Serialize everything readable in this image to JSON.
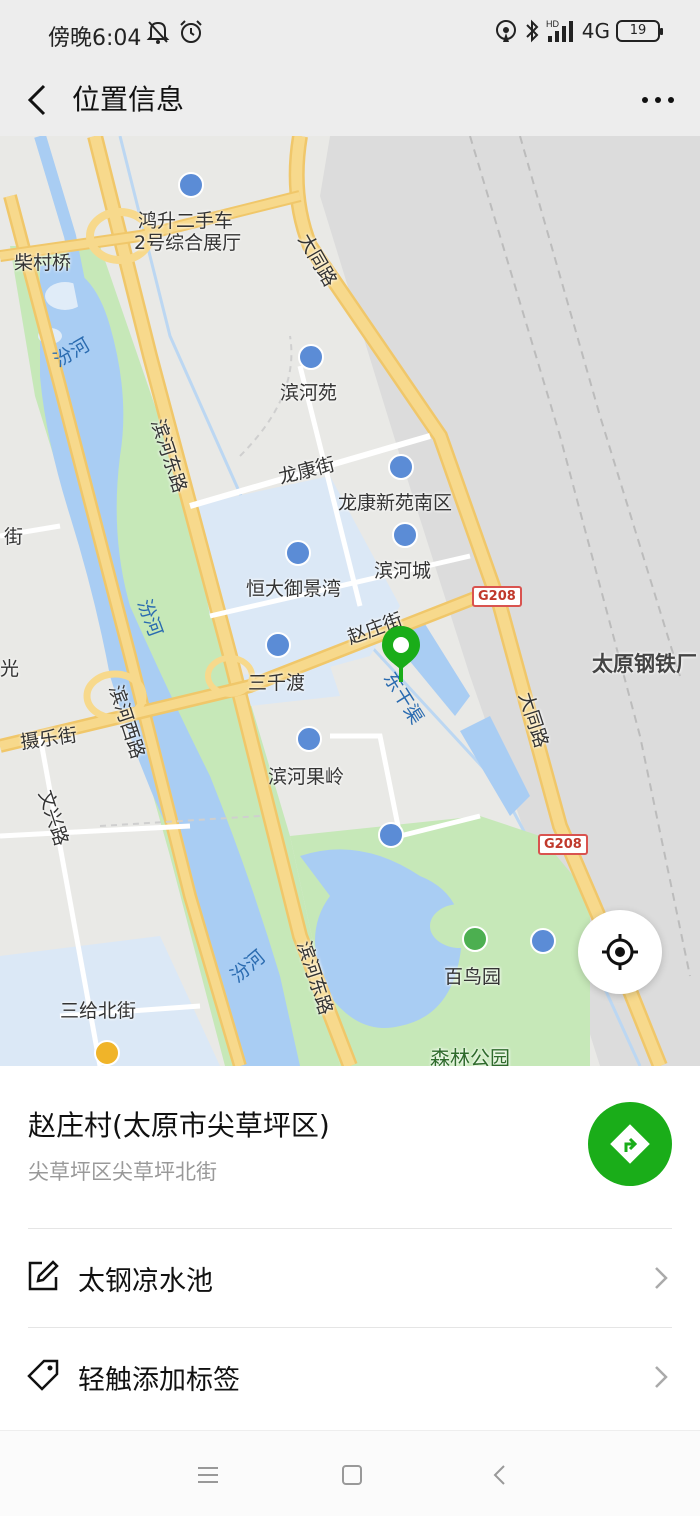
{
  "status_bar": {
    "time": "傍晚6:04",
    "network": "4G",
    "battery": "19",
    "icons": [
      "mute-bell-icon",
      "alarm-icon",
      "hotspot-icon",
      "bluetooth-icon",
      "signal-icon"
    ]
  },
  "header": {
    "title": "位置信息",
    "back_icon": "chevron-left-icon",
    "more_icon": "more-dots-icon"
  },
  "map": {
    "labels": {
      "chaicunqiao": "柴村桥",
      "fenhe_1": "汾河",
      "fenhe_2": "汾河",
      "fenhe_3": "汾河",
      "binhe_dong_1": "滨河东路",
      "binhe_dong_2": "滨河东路",
      "binhe_xi": "滨河西路",
      "hongsheng": "鸿升二手车",
      "hongsheng2": "2号综合展厅",
      "datong_1": "大同路",
      "datong_2": "大同路",
      "binheyuan": "滨河苑",
      "longkang_st": "龙康街",
      "longkang_nan": "龙康新苑南区",
      "binhecheng": "滨河城",
      "hengda": "恒大御景湾",
      "zhaozhuang_st": "赵庄街",
      "sanqiandu": "三千渡",
      "dongganqu": "东干渠",
      "taiyuan_gang": "太原钢铁厂",
      "shele_st": "摄乐街",
      "binhe_guoling": "滨河果岭",
      "wenxing": "文兴路",
      "baiyuan": "百鸟园",
      "senlin": "森林公园",
      "sangei": "三给北街",
      "guang": "光",
      "jie": "街"
    },
    "shields": {
      "g208_a": "G208",
      "g208_b": "G208"
    },
    "locate_icon": "crosshair-locate-icon",
    "pin_icon": "location-pin-icon"
  },
  "place": {
    "name": "赵庄村(太原市尖草坪区)",
    "address": "尖草坪区尖草坪北街",
    "nav_icon": "navigation-arrow-icon"
  },
  "rows": [
    {
      "label": "太钢凉水池",
      "icon": "edit-icon"
    },
    {
      "label": "轻触添加标签",
      "icon": "tag-icon"
    }
  ],
  "system_nav": [
    "menu-icon",
    "home-square-icon",
    "back-triangle-icon"
  ],
  "colors": {
    "accent_green": "#1aad19",
    "pin_green": "#1aad19",
    "water": "#a9cdf3",
    "park": "#c6e8b8",
    "road": "#f7d98c"
  }
}
